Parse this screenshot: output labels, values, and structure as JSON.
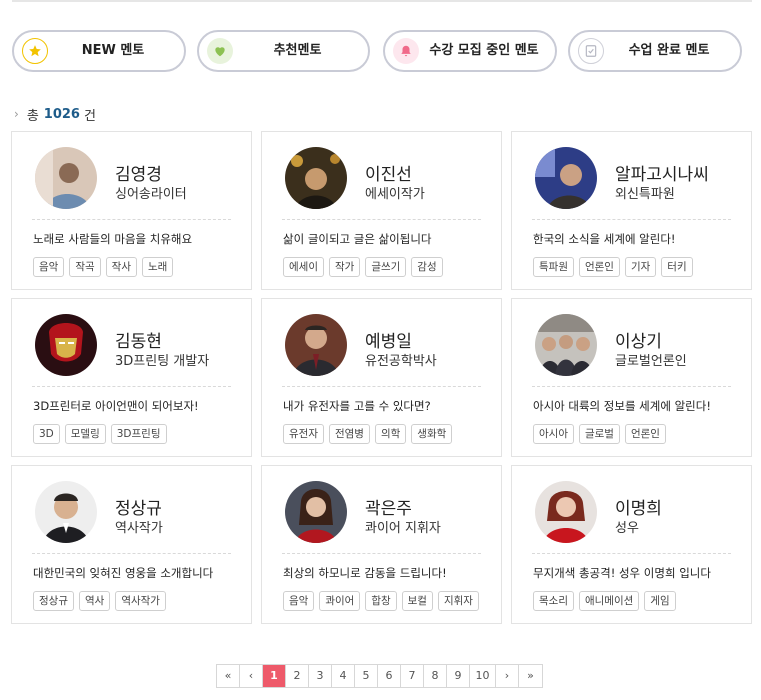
{
  "filters": [
    {
      "label": "NEW 멘토",
      "icon": "star-icon"
    },
    {
      "label": "추천멘토",
      "icon": "heart-icon"
    },
    {
      "label": "수강 모집 중인 멘토",
      "icon": "bell-icon"
    },
    {
      "label": "수업 완료 멘토",
      "icon": "checklist-icon"
    }
  ],
  "total": {
    "prefix": "총",
    "count": "1026",
    "suffix": "건"
  },
  "mentors": [
    {
      "name": "김영경",
      "role": "싱어송라이터",
      "desc": "노래로 사람들의 마음을 치유해요",
      "tags": [
        "음악",
        "작곡",
        "작사",
        "노래"
      ]
    },
    {
      "name": "이진선",
      "role": "에세이작가",
      "desc": "삶이 글이되고 글은 삶이됩니다",
      "tags": [
        "에세이",
        "작가",
        "글쓰기",
        "감성"
      ]
    },
    {
      "name": "알파고시나씨",
      "role": "외신특파원",
      "desc": "한국의 소식을 세계에 알린다!",
      "tags": [
        "특파원",
        "언론인",
        "기자",
        "터키"
      ]
    },
    {
      "name": "김동현",
      "role": "3D프린팅 개발자",
      "desc": "3D프린터로 아이언맨이 되어보자!",
      "tags": [
        "3D",
        "모델링",
        "3D프린팅"
      ]
    },
    {
      "name": "예병일",
      "role": "유전공학박사",
      "desc": "내가 유전자를 고를 수 있다면?",
      "tags": [
        "유전자",
        "전염병",
        "의학",
        "생화학"
      ]
    },
    {
      "name": "이상기",
      "role": "글로벌언론인",
      "desc": "아시아 대륙의 정보를 세계에 알린다!",
      "tags": [
        "아시아",
        "글로벌",
        "언론인"
      ]
    },
    {
      "name": "정상규",
      "role": "역사작가",
      "desc": "대한민국의 잊혀진 영웅을 소개합니다",
      "tags": [
        "정상규",
        "역사",
        "역사작가"
      ]
    },
    {
      "name": "곽은주",
      "role": "콰이어 지휘자",
      "desc": "최상의 하모니로 감동을 드립니다!",
      "tags": [
        "음악",
        "콰이어",
        "합창",
        "보컬",
        "지휘자"
      ]
    },
    {
      "name": "이명희",
      "role": "성우",
      "desc": "무지개색 총공격! 성우 이명희 입니다",
      "tags": [
        "목소리",
        "애니메이션",
        "게임"
      ]
    }
  ],
  "pagination": {
    "first": "«",
    "prev": "‹",
    "next": "›",
    "last": "»",
    "pages": [
      "1",
      "2",
      "3",
      "4",
      "5",
      "6",
      "7",
      "8",
      "9",
      "10"
    ],
    "current": "1"
  },
  "colors": {
    "accent": "#ee5a6a",
    "count": "#1e5c8a",
    "button_border": "#c9cbd6"
  }
}
